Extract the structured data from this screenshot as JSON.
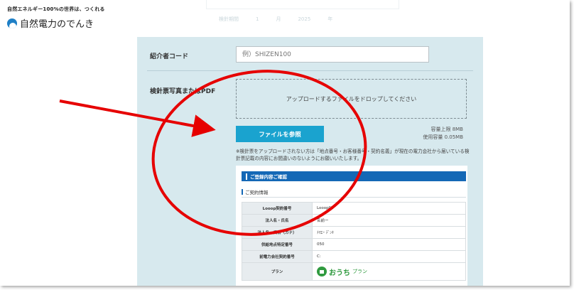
{
  "brand": {
    "tagline": "自然エネルギー100%の世界は、つくれる",
    "name": "自然電力のでんき"
  },
  "top_faded": {
    "label": "検針期間",
    "values": [
      "1",
      "月",
      "2025",
      "年"
    ]
  },
  "form": {
    "referrer": {
      "label": "紹介者コード",
      "placeholder": "例）SHIZEN100",
      "value": ""
    },
    "upload": {
      "label": "検針票写真またはPDF",
      "dropzone_text": "アップロードするファイルをドロップしてください",
      "button_label": "ファイルを参照",
      "capacity_limit": "容量上限 8MB",
      "capacity_used": "使用容量 0.05MB",
      "note": "※検針票をアップロードされない方は「地点番号・お客様番号・契約名義」が現在の電力会社から届いている検針票記載の内容にお間違いのないようにお願いいたします。"
    }
  },
  "confirmation": {
    "title": "ご登録内容ご確認",
    "section_label": "ご契約情報",
    "rows": [
      {
        "key": "Looop契約番号",
        "value": "Looop02"
      },
      {
        "key": "法人名・氏名",
        "value": "名前ー"
      },
      {
        "key": "法人名・氏名（カナ）",
        "value": "ﾅﾏｴｰ ﾃﾞﾝｷ"
      },
      {
        "key": "供給地点特定番号",
        "value": "050"
      },
      {
        "key": "前電力会社契約番号",
        "value": "C:"
      },
      {
        "key": "プラン",
        "value": ""
      }
    ],
    "plan": {
      "name": "おうち",
      "suffix": "プラン"
    }
  },
  "annotation": {
    "arrow_color": "#e60000",
    "circle_color": "#e60000"
  }
}
